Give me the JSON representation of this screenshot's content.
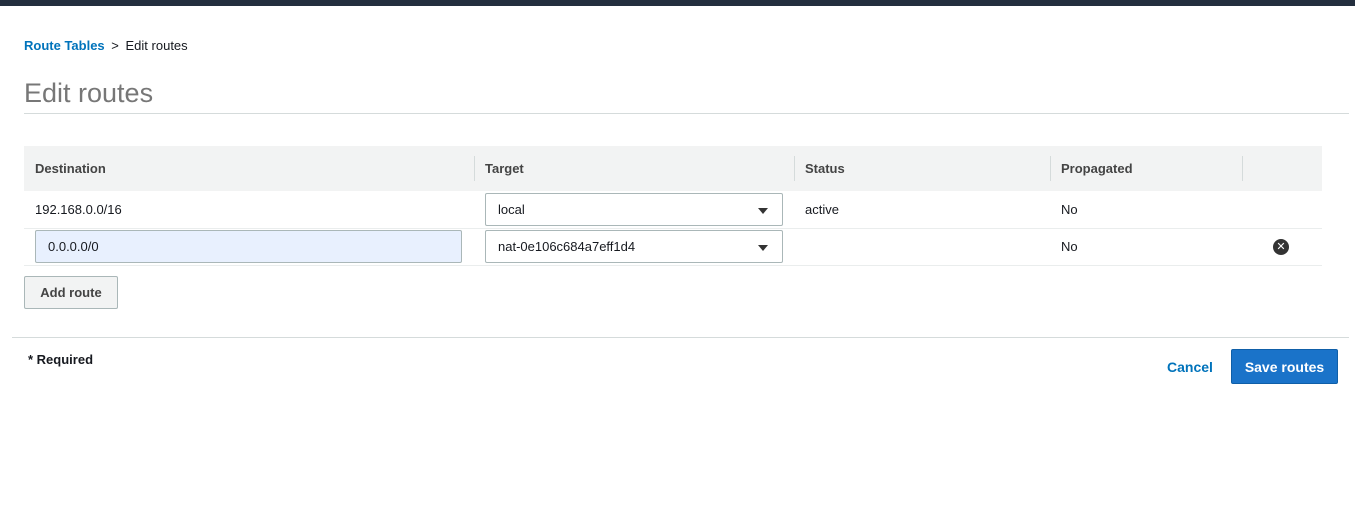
{
  "breadcrumb": {
    "parent": "Route Tables",
    "separator": ">",
    "current": "Edit routes"
  },
  "page_title": "Edit routes",
  "table": {
    "headers": [
      "Destination",
      "Target",
      "Status",
      "Propagated"
    ],
    "rows": [
      {
        "destination": "192.168.0.0/16",
        "target": "local",
        "status": "active",
        "propagated": "No"
      },
      {
        "destination": "0.0.0.0/0",
        "target": "nat-0e106c684a7eff1d4",
        "status": "",
        "propagated": "No"
      }
    ]
  },
  "add_route_label": "Add route",
  "required_note": "* Required",
  "cancel_label": "Cancel",
  "save_label": "Save routes",
  "icons": {
    "remove": "remove-circle-icon",
    "dropdown": "caret-down-icon"
  },
  "colors": {
    "link": "#0073bb",
    "primary_button": "#1a73c9",
    "status_active": "#1d8102",
    "topbar": "#232f3e"
  }
}
